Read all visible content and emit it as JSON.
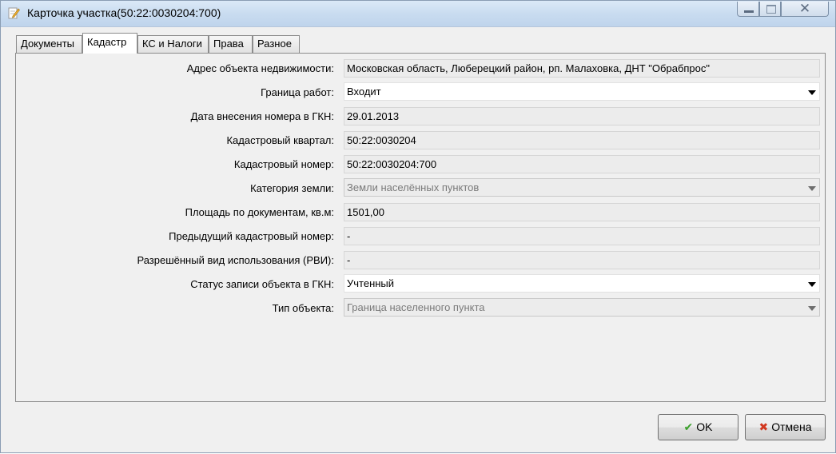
{
  "window": {
    "title": "Карточка участка(50:22:0030204:700)",
    "close_symbol": "✕"
  },
  "tabs": [
    {
      "label": "Документы"
    },
    {
      "label": "Кадастр"
    },
    {
      "label": "КС и Налоги"
    },
    {
      "label": "Права"
    },
    {
      "label": "Разное"
    }
  ],
  "active_tab": "Кадастр",
  "form": {
    "address": {
      "label": "Адрес объекта недвижимости:",
      "value": "Московская область, Люберецкий район, рп. Малаховка, ДНТ \"Обрабпрос\""
    },
    "work_boundary": {
      "label": "Граница работ:",
      "value": "Входит"
    },
    "gkn_date": {
      "label": "Дата внесения номера в ГКН:",
      "value": "29.01.2013"
    },
    "cad_quarter": {
      "label": "Кадастровый квартал:",
      "value": "50:22:0030204"
    },
    "cad_number": {
      "label": "Кадастровый номер:",
      "value": "50:22:0030204:700"
    },
    "land_category": {
      "label": "Категория земли:",
      "value": "Земли населённых пунктов"
    },
    "area": {
      "label": "Площадь по документам, кв.м:",
      "value": "1501,00"
    },
    "prev_cad_number": {
      "label": "Предыдущий кадастровый номер:",
      "value": "-"
    },
    "permitted_use": {
      "label": "Разрешённый вид использования (РВИ):",
      "value": "-"
    },
    "gkn_status": {
      "label": "Статус записи объекта в ГКН:",
      "value": "Учтенный"
    },
    "object_type": {
      "label": "Тип объекта:",
      "value": "Граница населенного пункта"
    }
  },
  "buttons": {
    "ok": {
      "label": "OK",
      "icon": "checkmark-icon"
    },
    "cancel": {
      "label": "Отмена",
      "icon": "cross-icon"
    }
  },
  "colors": {
    "ok_icon": "#3aa02a",
    "cancel_icon": "#d2371f"
  }
}
